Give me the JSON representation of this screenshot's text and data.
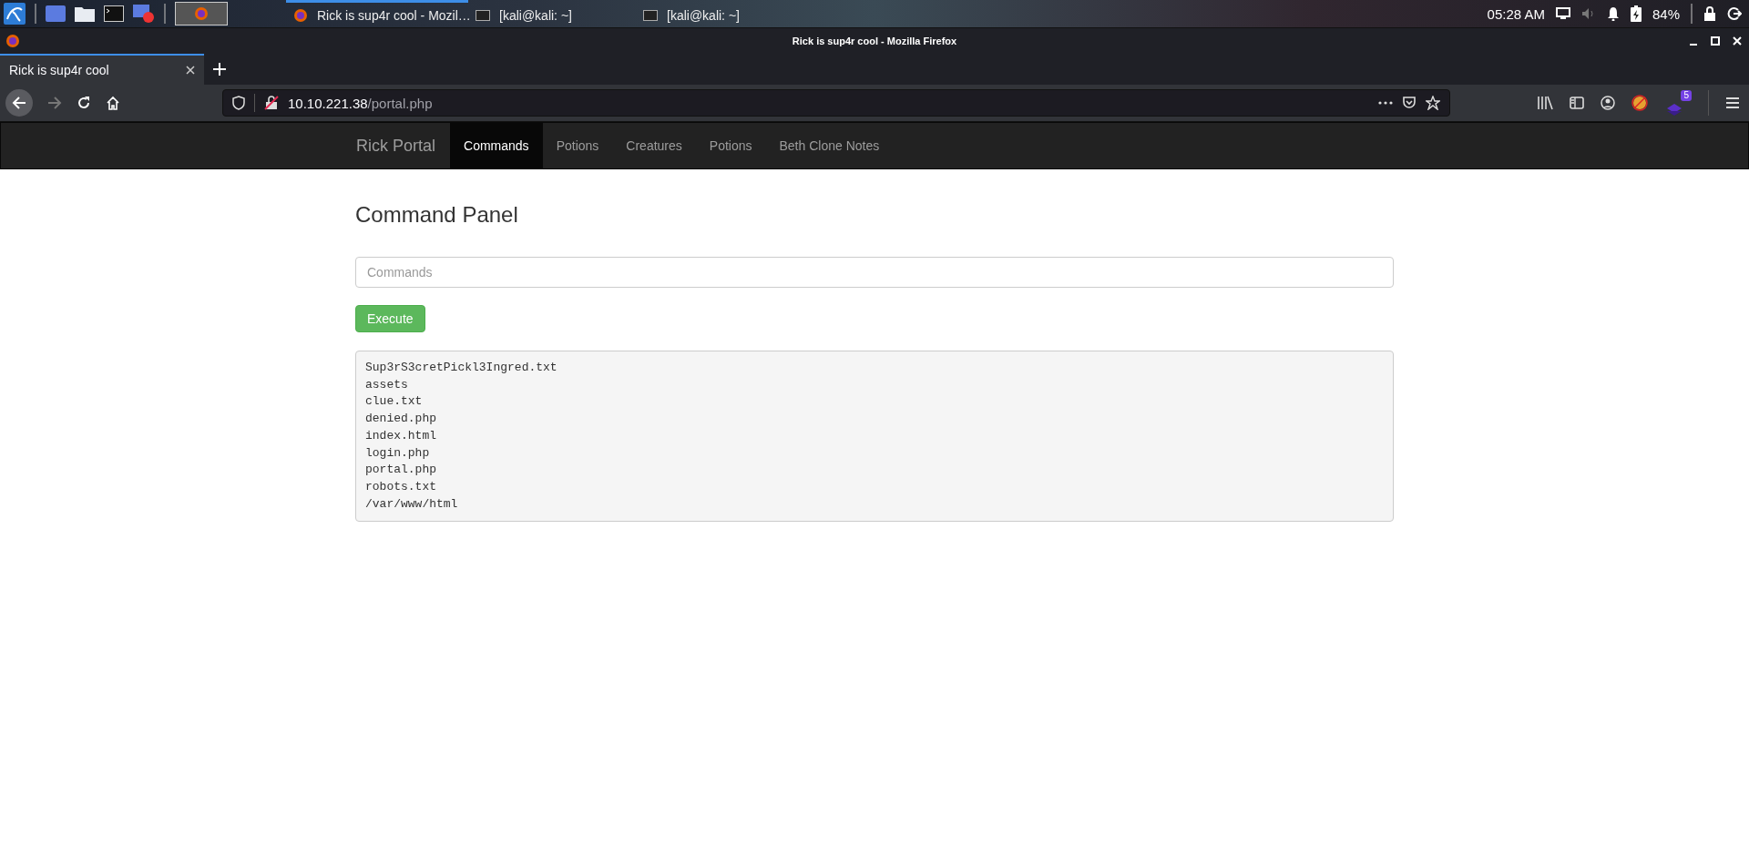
{
  "taskbar": {
    "tasks": [
      {
        "label": "Rick is sup4r cool - Mozil…",
        "selected": true,
        "kind": "browser"
      },
      {
        "label": "[kali@kali: ~]",
        "selected": false,
        "kind": "terminal"
      },
      {
        "label": "[kali@kali: ~]",
        "selected": false,
        "kind": "terminal"
      }
    ],
    "clock": "05:28 AM",
    "battery": "84%"
  },
  "window": {
    "title": "Rick is sup4r cool - Mozilla Firefox"
  },
  "tabs": [
    {
      "label": "Rick is sup4r cool",
      "selected": true
    }
  ],
  "url": {
    "host": "10.10.221.38",
    "path": "/portal.php"
  },
  "toolbar": {
    "extension_badge": "5"
  },
  "navbar": {
    "brand": "Rick Portal",
    "items": [
      {
        "label": "Commands",
        "selected": true
      },
      {
        "label": "Potions",
        "selected": false
      },
      {
        "label": "Creatures",
        "selected": false
      },
      {
        "label": "Potions",
        "selected": false
      },
      {
        "label": "Beth Clone Notes",
        "selected": false
      }
    ]
  },
  "page": {
    "heading": "Command Panel",
    "command_field": {
      "placeholder": "Commands"
    },
    "execute_button": "Execute",
    "output": [
      "Sup3rS3cretPickl3Ingred.txt",
      "assets",
      "clue.txt",
      "denied.php",
      "index.html",
      "login.php",
      "portal.php",
      "robots.txt",
      "/var/www/html"
    ]
  }
}
